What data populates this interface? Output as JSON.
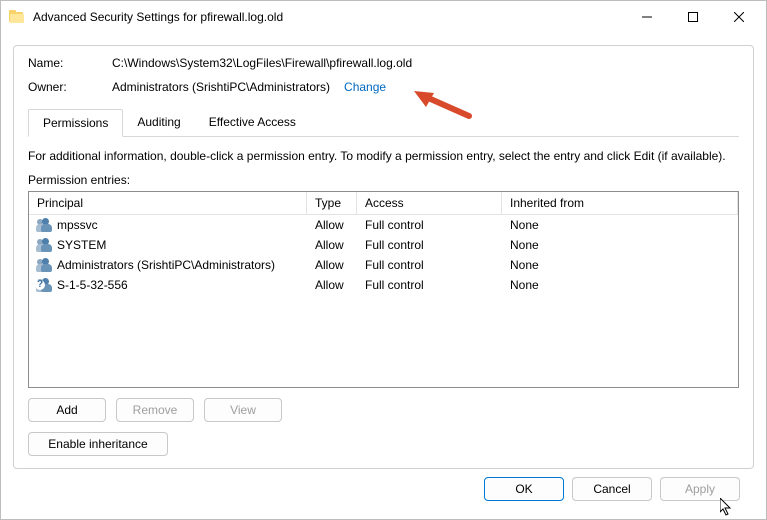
{
  "window": {
    "title": "Advanced Security Settings for pfirewall.log.old"
  },
  "fields": {
    "name_label": "Name:",
    "name_value": "C:\\Windows\\System32\\LogFiles\\Firewall\\pfirewall.log.old",
    "owner_label": "Owner:",
    "owner_value": "Administrators (SrishtiPC\\Administrators)",
    "change_link": "Change"
  },
  "tabs": {
    "permissions": "Permissions",
    "auditing": "Auditing",
    "effective": "Effective Access"
  },
  "info_text": "For additional information, double-click a permission entry. To modify a permission entry, select the entry and click Edit (if available).",
  "entries_label": "Permission entries:",
  "columns": {
    "principal": "Principal",
    "type": "Type",
    "access": "Access",
    "inherited": "Inherited from"
  },
  "rows": [
    {
      "icon": "group",
      "principal": "mpssvc",
      "type": "Allow",
      "access": "Full control",
      "inherited": "None"
    },
    {
      "icon": "group",
      "principal": "SYSTEM",
      "type": "Allow",
      "access": "Full control",
      "inherited": "None"
    },
    {
      "icon": "group",
      "principal": "Administrators (SrishtiPC\\Administrators)",
      "type": "Allow",
      "access": "Full control",
      "inherited": "None"
    },
    {
      "icon": "unknown",
      "principal": "S-1-5-32-556",
      "type": "Allow",
      "access": "Full control",
      "inherited": "None"
    }
  ],
  "buttons": {
    "add": "Add",
    "remove": "Remove",
    "view": "View",
    "enable_inheritance": "Enable inheritance",
    "ok": "OK",
    "cancel": "Cancel",
    "apply": "Apply"
  }
}
